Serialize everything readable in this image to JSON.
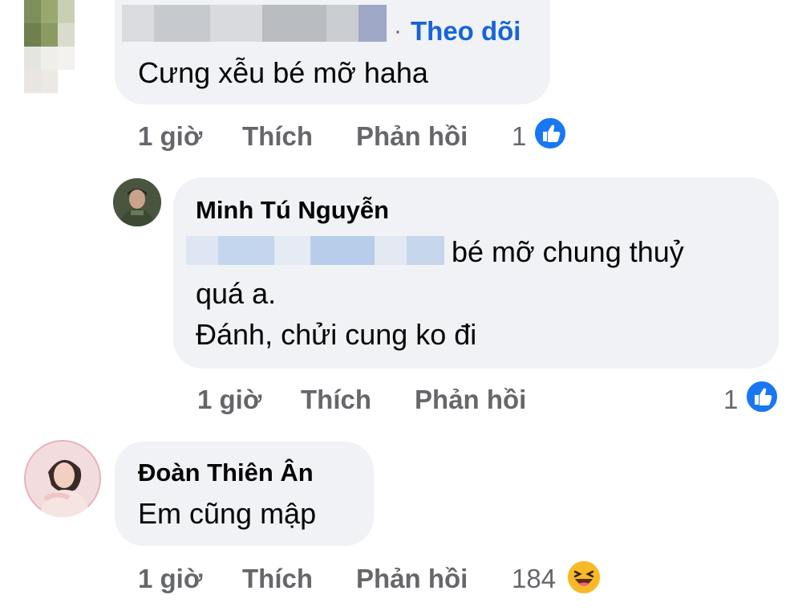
{
  "comments": [
    {
      "author": "",
      "follow_label": "Theo dõi",
      "follow_dot": "·",
      "text": "Cưng xễu bé mỡ haha",
      "time": "1 giờ",
      "like_label": "Thích",
      "reply_label": "Phản hồi",
      "reaction_count": "1",
      "reaction_icon": "like-icon"
    },
    {
      "author": "Minh Tú Nguyễn",
      "text_line1": "bé mỡ chung thuỷ",
      "text_line2": "quá a.",
      "text_line3": "Đánh, chửi cung ko đi",
      "time": "1 giờ",
      "like_label": "Thích",
      "reply_label": "Phản hồi",
      "reaction_count": "1",
      "reaction_icon": "like-icon"
    },
    {
      "author": "Đoàn Thiên Ân",
      "text": "Em cũng mập",
      "time": "1 giờ",
      "like_label": "Thích",
      "reply_label": "Phản hồi",
      "reaction_count": "184",
      "reaction_icon": "haha-icon"
    }
  ],
  "colors": {
    "bubble": "#f0f2f5",
    "meta_text": "#65676b",
    "link_blue": "#1664d9",
    "like_blue": "#1877f2",
    "haha_yellow": "#f7b125"
  }
}
